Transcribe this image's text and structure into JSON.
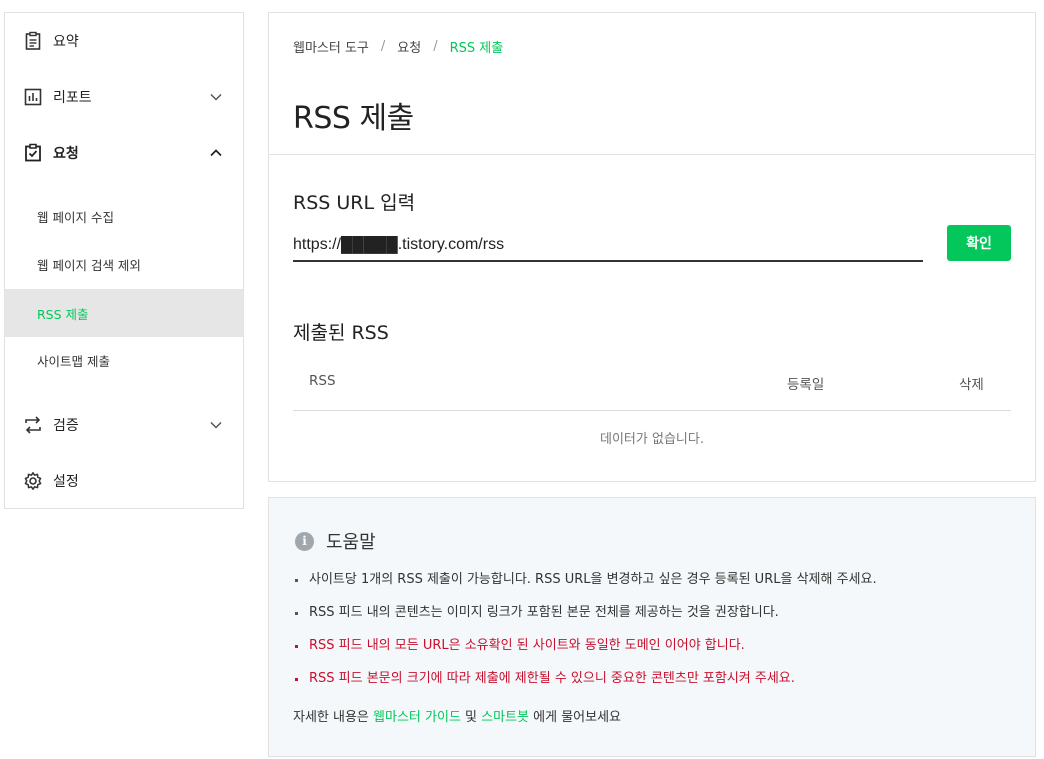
{
  "sidebar": {
    "items": [
      {
        "label": "요약",
        "icon": "clipboard-icon"
      },
      {
        "label": "리포트",
        "icon": "bar-chart-icon"
      },
      {
        "label": "요청",
        "icon": "checked-clipboard-icon"
      },
      {
        "label": "검증",
        "icon": "swap-arrows-icon"
      },
      {
        "label": "설정",
        "icon": "gear-icon"
      }
    ],
    "sub_items": [
      {
        "label": "웹 페이지 수집"
      },
      {
        "label": "웹 페이지 검색 제외"
      },
      {
        "label": "RSS 제출"
      },
      {
        "label": "사이트맵 제출"
      }
    ]
  },
  "breadcrumb": {
    "root": "웹마스터 도구",
    "sep": "/",
    "mid": "요청",
    "current": "RSS 제출"
  },
  "page_title": "RSS 제출",
  "rss_input": {
    "label": "RSS URL 입력",
    "value": "https://█████.tistory.com/rss",
    "button": "확인"
  },
  "submitted": {
    "label": "제출된 RSS",
    "columns": [
      "RSS",
      "등록일",
      "삭제"
    ],
    "empty": "데이터가 없습니다."
  },
  "help": {
    "title": "도움말",
    "items": [
      "사이트당 1개의 RSS 제출이 가능합니다. RSS URL을 변경하고 싶은 경우 등록된 URL을 삭제해 주세요.",
      "RSS 피드 내의 콘텐츠는 이미지 링크가 포함된 본문 전체를 제공하는 것을 권장합니다.",
      "RSS 피드 내의 모든 URL은 소유확인 된 사이트와 동일한 도메인 이어야 합니다.",
      "RSS 피드 본문의 크기에 따라 제출에 제한될 수 있으니 중요한 콘텐츠만 포함시켜 주세요."
    ],
    "footer_prefix": "자세한 내용은",
    "link_guide": "웹마스터 가이드",
    "and": "및",
    "link_bot": "스마트봇",
    "footer_suffix": "에게 물어보세요"
  },
  "colors": {
    "accent": "#03c75a",
    "warning": "#c8102e"
  }
}
